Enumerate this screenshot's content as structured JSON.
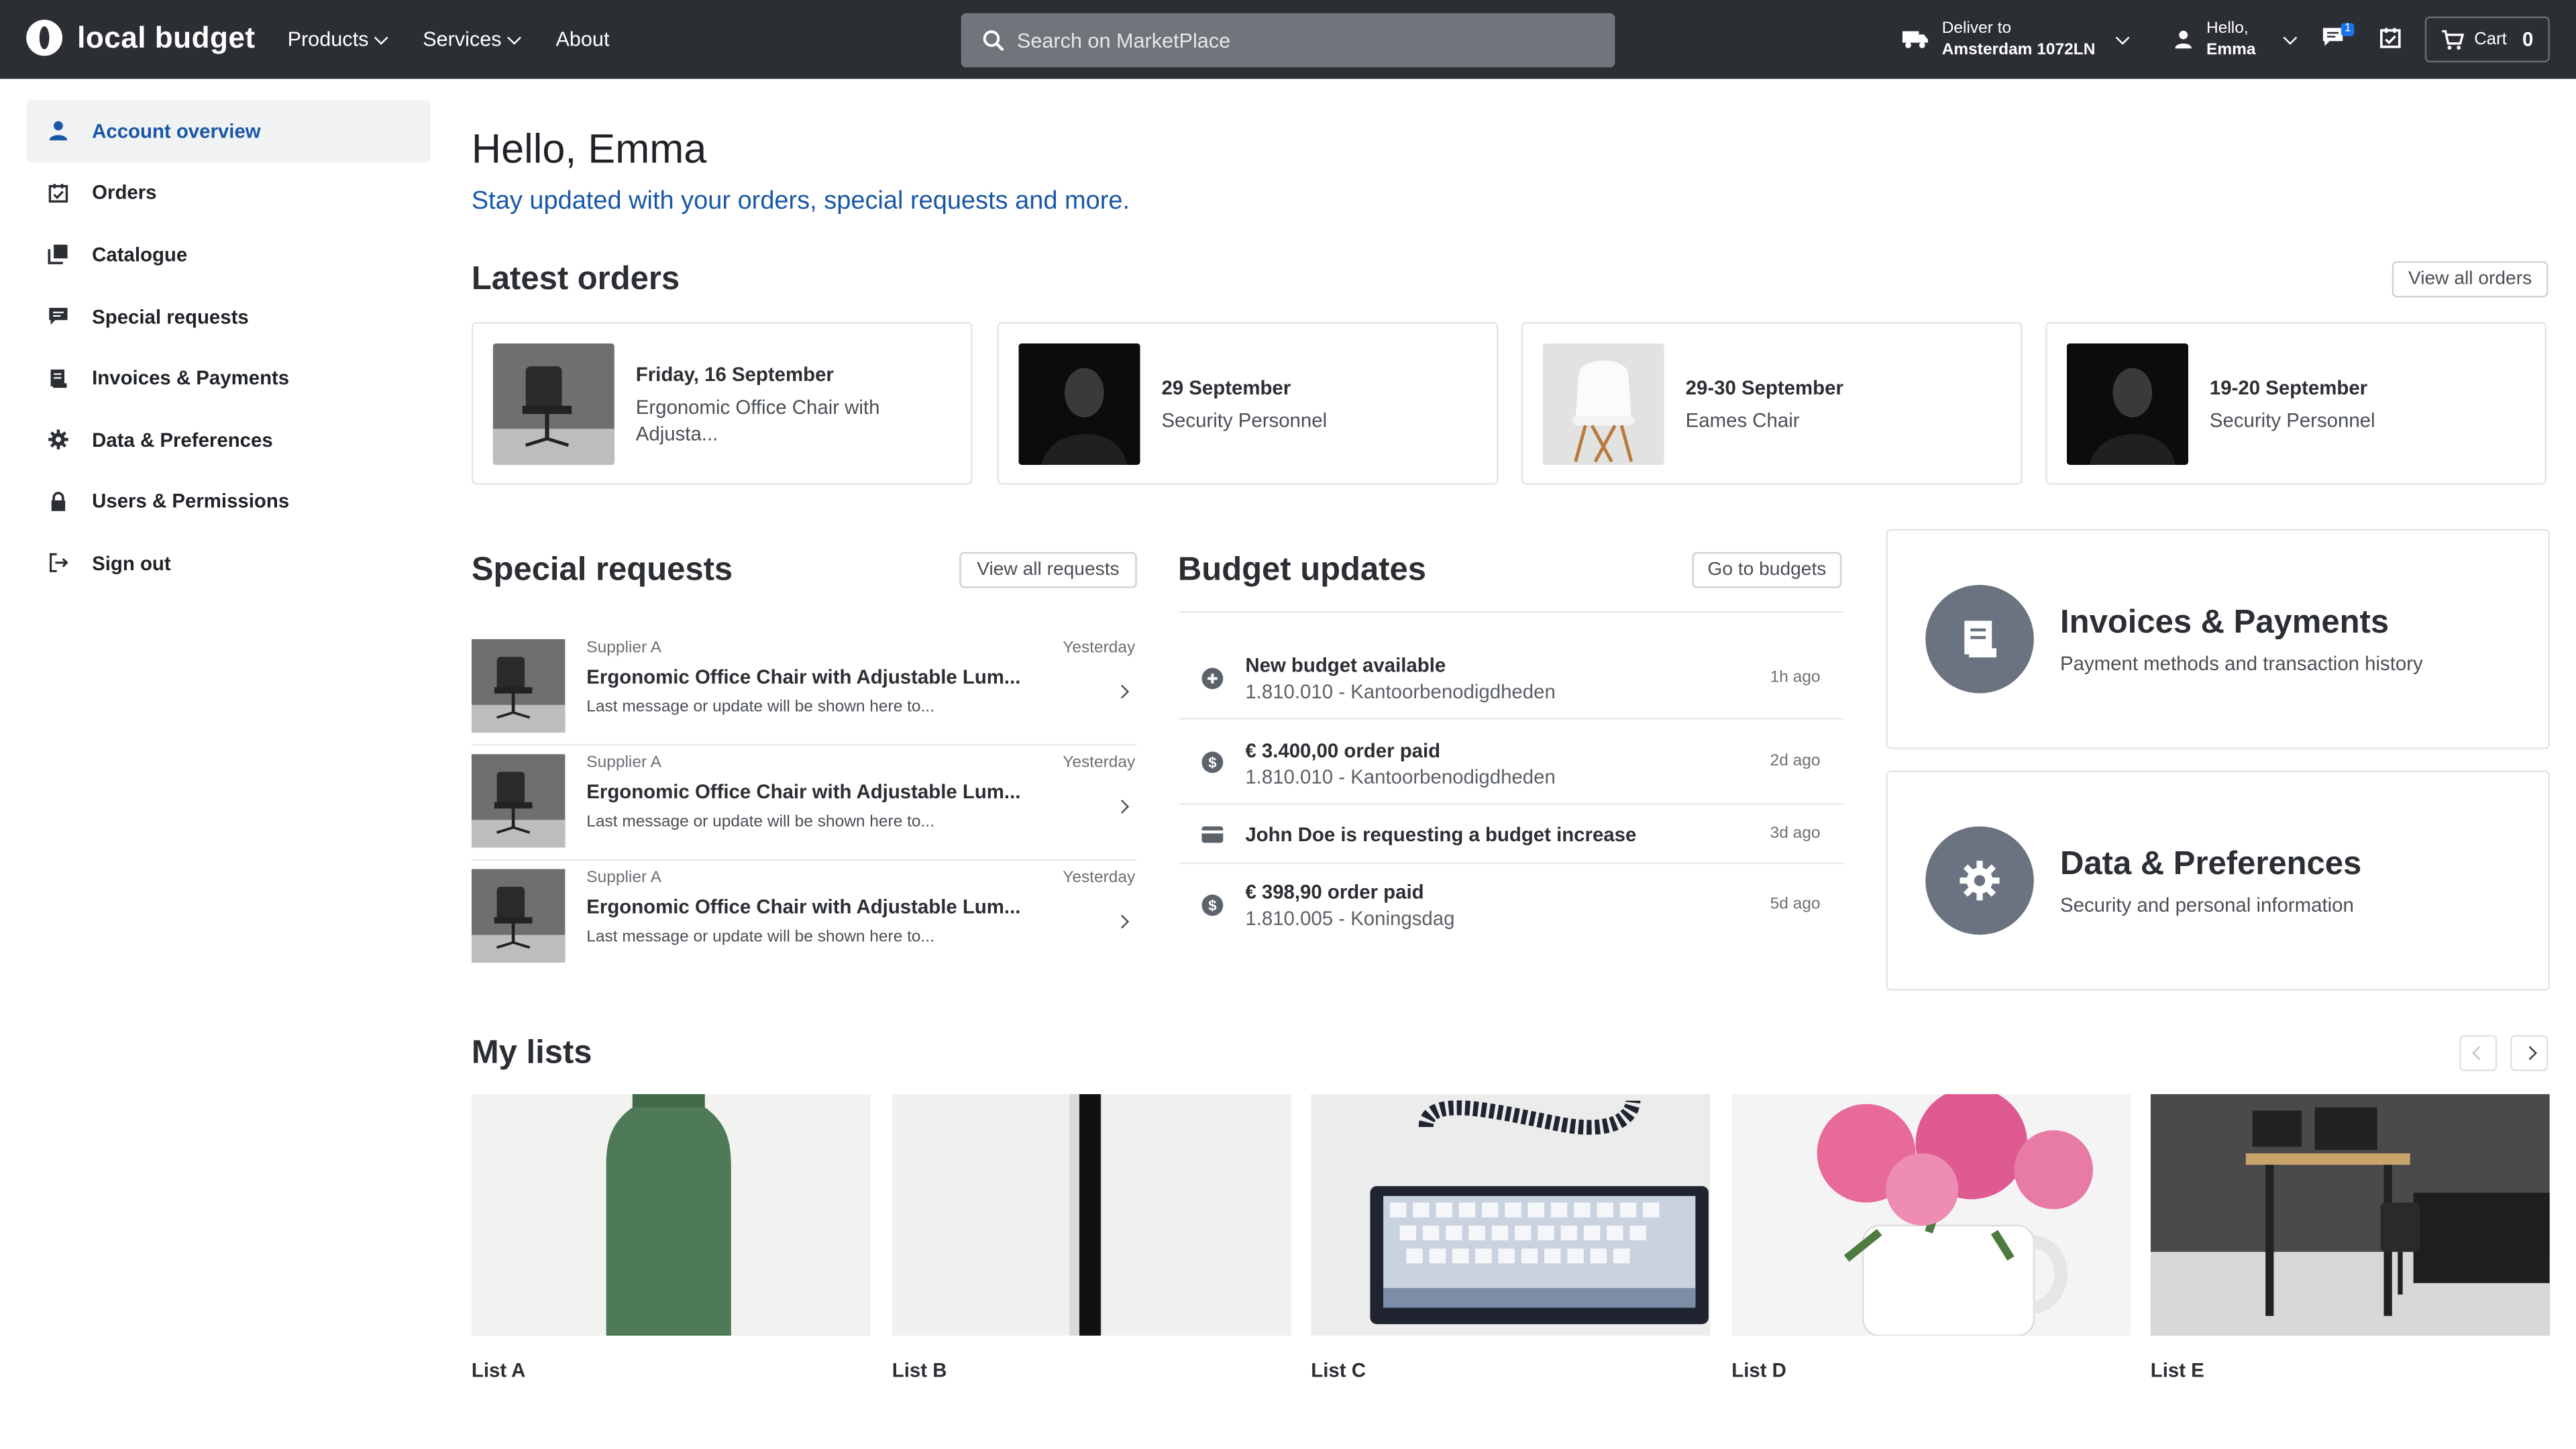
{
  "brand": {
    "name": "local budget"
  },
  "nav": {
    "products": "Products",
    "services": "Services",
    "about": "About"
  },
  "search": {
    "placeholder": "Search on MarketPlace"
  },
  "deliver": {
    "label": "Deliver to",
    "location": "Amsterdam 1072LN"
  },
  "user": {
    "greeting": "Hello,",
    "name": "Emma"
  },
  "messages": {
    "count": "1"
  },
  "cart": {
    "label": "Cart",
    "count": "0"
  },
  "sidebar": {
    "items": [
      {
        "label": "Account overview",
        "icon": "person-icon"
      },
      {
        "label": "Orders",
        "icon": "orders-icon"
      },
      {
        "label": "Catalogue",
        "icon": "catalogue-icon"
      },
      {
        "label": "Special requests",
        "icon": "chat-icon"
      },
      {
        "label": "Invoices & Payments",
        "icon": "receipt-icon"
      },
      {
        "label": "Data & Preferences",
        "icon": "gear-icon"
      },
      {
        "label": "Users & Permissions",
        "icon": "lock-icon"
      },
      {
        "label": "Sign out",
        "icon": "sign-out-icon"
      }
    ]
  },
  "main": {
    "title": "Hello, Emma",
    "subtitle": "Stay updated with your orders, special requests and more."
  },
  "latest_orders": {
    "title": "Latest orders",
    "view_all": "View all orders",
    "items": [
      {
        "date": "Friday, 16 September",
        "desc": "Ergonomic Office Chair with Adjusta..."
      },
      {
        "date": "29 September",
        "desc": "Security Personnel"
      },
      {
        "date": "29-30 September",
        "desc": "Eames Chair"
      },
      {
        "date": "19-20 September",
        "desc": "Security Personnel"
      }
    ]
  },
  "special_requests": {
    "title": "Special requests",
    "view_all": "View all requests",
    "items": [
      {
        "supplier": "Supplier A",
        "title": "Ergonomic Office Chair with Adjustable Lum...",
        "message": "Last message or update will be shown here to...",
        "when": "Yesterday"
      },
      {
        "supplier": "Supplier A",
        "title": "Ergonomic Office Chair with Adjustable Lum...",
        "message": "Last message or update will be shown here to...",
        "when": "Yesterday"
      },
      {
        "supplier": "Supplier A",
        "title": "Ergonomic Office Chair with Adjustable Lum...",
        "message": "Last message or update will be shown here to...",
        "when": "Yesterday"
      }
    ]
  },
  "budget_updates": {
    "title": "Budget updates",
    "go_to": "Go to budgets",
    "items": [
      {
        "title": "New budget available",
        "detail": "1.810.010 - Kantoorbenodigdheden",
        "ago": "1h ago",
        "icon": "plus-circle-icon"
      },
      {
        "title": "€ 3.400,00 order paid",
        "detail": "1.810.010 - Kantoorbenodigdheden",
        "ago": "2d ago",
        "icon": "dollar-circle-icon"
      },
      {
        "title": "John Doe is requesting a budget increase",
        "detail": "",
        "ago": "3d ago",
        "icon": "card-icon"
      },
      {
        "title": "€ 398,90 order paid",
        "detail": "1.810.005 - Koningsdag",
        "ago": "5d ago",
        "icon": "dollar-circle-icon"
      }
    ]
  },
  "invoices_card": {
    "title": "Invoices & Payments",
    "subtitle": "Payment methods and transaction history",
    "icon": "receipt-icon"
  },
  "data_card": {
    "title": "Data & Preferences",
    "subtitle": "Security and personal information",
    "icon": "gear-icon"
  },
  "my_lists": {
    "title": "My lists",
    "items": [
      {
        "name": "List A"
      },
      {
        "name": "List B"
      },
      {
        "name": "List C"
      },
      {
        "name": "List D"
      },
      {
        "name": "List E"
      }
    ]
  },
  "colors": {
    "topbar": "#2b2e33",
    "accent": "#1957a6",
    "icon_circle": "#6b7381"
  }
}
